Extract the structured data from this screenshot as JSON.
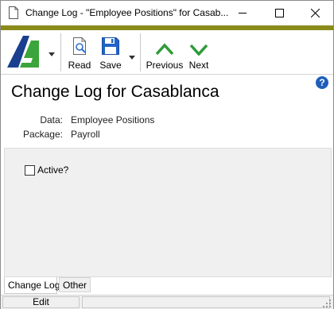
{
  "window": {
    "title": "Change Log - \"Employee Positions\" for Casab..."
  },
  "toolbar": {
    "read_label": "Read",
    "save_label": "Save",
    "previous_label": "Previous",
    "next_label": "Next"
  },
  "header": {
    "title": "Change Log for Casablanca",
    "help_glyph": "?"
  },
  "info": {
    "data_label": "Data:",
    "data_value": "Employee Positions",
    "package_label": "Package:",
    "package_value": "Payroll"
  },
  "form": {
    "active_label": "Active?",
    "active_checked": false
  },
  "tabs": [
    {
      "label": "Change Log",
      "active": true
    },
    {
      "label": "Other",
      "active": false
    }
  ],
  "status": {
    "mode": "Edit"
  },
  "colors": {
    "accent_band": "#8a8a1a",
    "logo_blue": "#1a3f8f",
    "logo_green": "#3aa53a",
    "arrow_green": "#2e9b3a",
    "help_blue": "#1f5fb8"
  }
}
